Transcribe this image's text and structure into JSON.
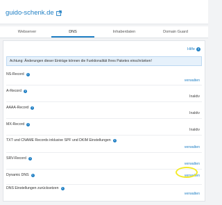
{
  "domain": {
    "name": "guido-schenk.de",
    "icon": "external-link-icon"
  },
  "tabs": [
    {
      "label": "Webserver",
      "active": false
    },
    {
      "label": "DNS",
      "active": true
    },
    {
      "label": "Inhaberdaten",
      "active": false
    },
    {
      "label": "Domain Guard",
      "active": false
    }
  ],
  "help": {
    "label": "Hilfe",
    "icon": "help-icon"
  },
  "notice": "Achtung: Änderungen dieser Einträge können die Funktionalität Ihres Paketes einschränken!",
  "records": [
    {
      "label": "NS-Record",
      "action": "verwalten",
      "action_type": "link"
    },
    {
      "label": "A-Record",
      "action": "Inaktiv",
      "action_type": "status"
    },
    {
      "label": "AAAA-Record",
      "action": "Inaktiv",
      "action_type": "status"
    },
    {
      "label": "MX-Record",
      "action": "Inaktiv",
      "action_type": "status"
    },
    {
      "label": "TXT und CNAME Records inklusive SPF und DKIM Einstellungen",
      "action": "verwalten",
      "action_type": "link"
    },
    {
      "label": "SRV-Record",
      "action": "verwalten",
      "action_type": "link"
    },
    {
      "label": "Dynamic DNS",
      "action": "verwalten",
      "action_type": "link"
    },
    {
      "label": "DNS Einstellungen zurücksetzen",
      "action": "verwalten",
      "action_type": "link"
    }
  ],
  "colors": {
    "accent": "#1f7fc4",
    "highlight": "#f3ea2a",
    "notice_bg": "#e6f1fb"
  }
}
